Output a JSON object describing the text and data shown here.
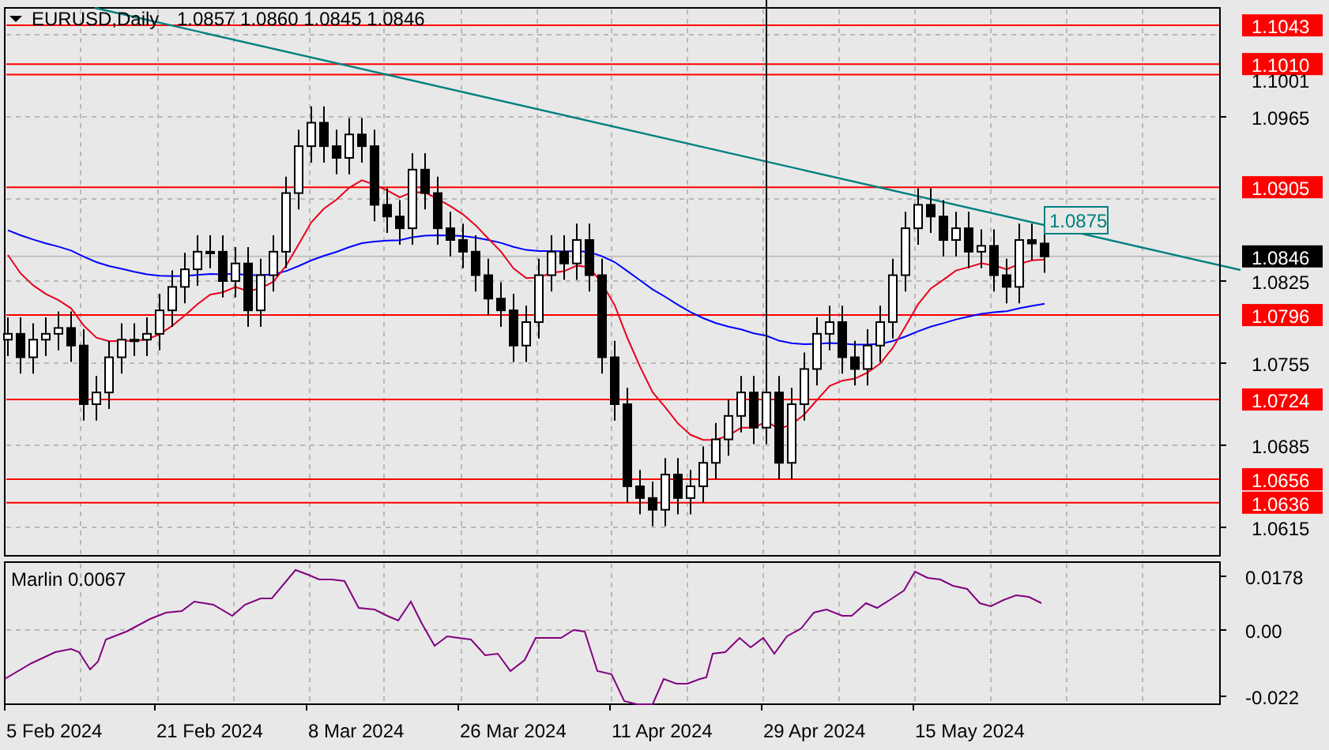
{
  "header": {
    "title": "EURUSD,Daily",
    "ohlc": "1.0857 1.0860 1.0845 1.0846"
  },
  "price_axis": {
    "ticks": [
      "1.0965",
      "1.0825",
      "1.0755",
      "1.0685",
      "1.0615"
    ]
  },
  "levels": [
    {
      "label": "1.1043",
      "kind": "marked"
    },
    {
      "label": "1.1010",
      "kind": "marked"
    },
    {
      "label": "1.1001",
      "kind": "plain"
    },
    {
      "label": "1.0905",
      "kind": "marked"
    },
    {
      "label": "1.0796",
      "kind": "marked"
    },
    {
      "label": "1.0724",
      "kind": "marked"
    },
    {
      "label": "1.0656",
      "kind": "marked"
    },
    {
      "label": "1.0636",
      "kind": "marked"
    }
  ],
  "current_price": {
    "label": "1.0846"
  },
  "trendline": {
    "label": "1.0875"
  },
  "indicator": {
    "title": "Marlin 0.0067",
    "ticks": [
      "0.0178",
      "0.00",
      "-0.022"
    ]
  },
  "date_axis": {
    "labels": [
      "5 Feb 2024",
      "21 Feb 2024",
      "8 Mar 2024",
      "26 Mar 2024",
      "11 Apr 2024",
      "29 Apr 2024",
      "15 May 2024"
    ]
  }
}
